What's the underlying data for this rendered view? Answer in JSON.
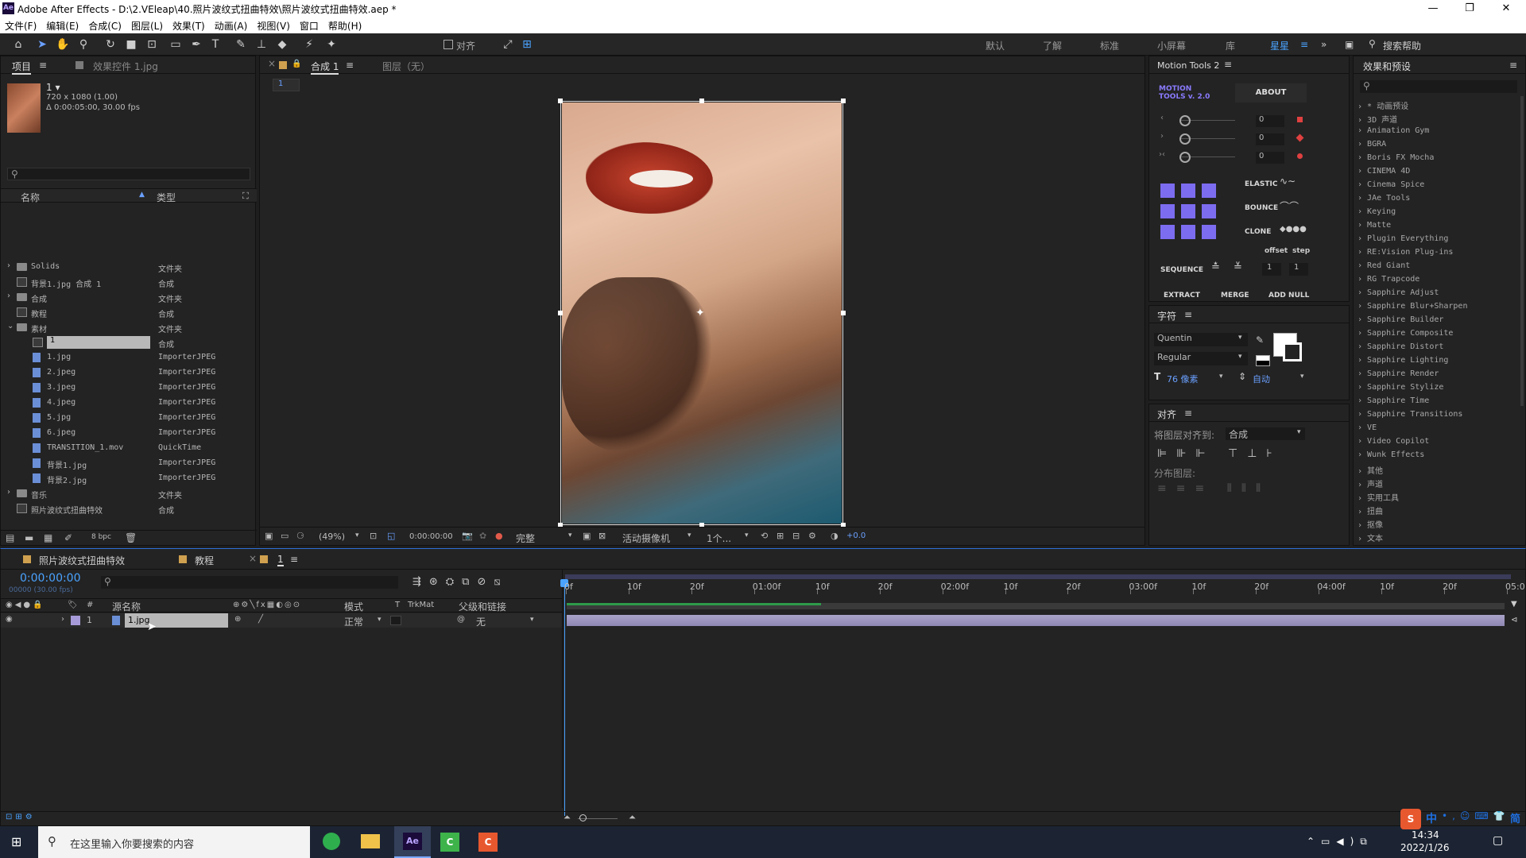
{
  "titlebar": {
    "app_icon": "Ae",
    "title": "Adobe After Effects - D:\\2.VEleap\\40.照片波纹式扭曲特效\\照片波纹式扭曲特效.aep *",
    "minimize": "—",
    "maximize": "❐",
    "close": "✕"
  },
  "menu": [
    "文件(F)",
    "编辑(E)",
    "合成(C)",
    "图层(L)",
    "效果(T)",
    "动画(A)",
    "视图(V)",
    "窗口",
    "帮助(H)"
  ],
  "toolbar": {
    "align_label": "对齐",
    "workspaces": [
      "默认",
      "了解",
      "标准",
      "小屏幕",
      "库",
      "星星"
    ],
    "search_placeholder": "搜索帮助"
  },
  "project": {
    "tab_project": "项目",
    "tab_effects": "效果控件 1.jpg",
    "preview": {
      "name": "1 ▾",
      "size": "720 x 1080 (1.00)",
      "duration": "Δ 0:00:05:00, 30.00 fps"
    },
    "search_placeholder": "",
    "col_name": "名称",
    "col_type": "类型",
    "rows": [
      {
        "name": "Solids",
        "type": "文件夹",
        "icon": "folder"
      },
      {
        "name": "背景1.jpg 合成 1",
        "type": "合成",
        "icon": "comp"
      },
      {
        "name": "合成",
        "type": "文件夹",
        "icon": "folder"
      },
      {
        "name": "教程",
        "type": "合成",
        "icon": "comp"
      },
      {
        "name": "素材",
        "type": "文件夹",
        "icon": "folder"
      },
      {
        "name": "1",
        "type": "合成",
        "icon": "comp"
      },
      {
        "name": "1.jpg",
        "type": "ImporterJPEG",
        "icon": "file"
      },
      {
        "name": "2.jpeg",
        "type": "ImporterJPEG",
        "icon": "file"
      },
      {
        "name": "3.jpeg",
        "type": "ImporterJPEG",
        "icon": "file"
      },
      {
        "name": "4.jpeg",
        "type": "ImporterJPEG",
        "icon": "file"
      },
      {
        "name": "5.jpg",
        "type": "ImporterJPEG",
        "icon": "file"
      },
      {
        "name": "6.jpeg",
        "type": "ImporterJPEG",
        "icon": "file"
      },
      {
        "name": "TRANSITION_1.mov",
        "type": "QuickTime",
        "icon": "file"
      },
      {
        "name": "背景1.jpg",
        "type": "ImporterJPEG",
        "icon": "file"
      },
      {
        "name": "背景2.jpg",
        "type": "ImporterJPEG",
        "icon": "file"
      },
      {
        "name": "音乐",
        "type": "文件夹",
        "icon": "folder"
      },
      {
        "name": "照片波纹式扭曲特效",
        "type": "合成",
        "icon": "comp"
      }
    ],
    "bpc": "8 bpc"
  },
  "comp": {
    "tab": "合成 1",
    "layer_tab": "图层（无）",
    "breadcrumb": "1",
    "zoom": "(49%)",
    "time": "0:00:00:00",
    "quality": "完整",
    "camera": "活动摄像机",
    "views": "1个...",
    "exposure": "+0.0"
  },
  "motion_tools": {
    "title": "Motion Tools 2",
    "logo": "MOTION\nTOOLS v. 2.0",
    "about": "ABOUT",
    "values": [
      "0",
      "0",
      "0"
    ],
    "elastic": "ELASTIC",
    "bounce": "BOUNCE",
    "clone": "CLONE",
    "offset": "offset",
    "step": "step",
    "sequence": "SEQUENCE",
    "seq_values": [
      "1",
      "1"
    ],
    "extract": "EXTRACT",
    "merge": "MERGE",
    "add_null": "ADD NULL"
  },
  "character": {
    "title": "字符",
    "font": "Quentin",
    "style": "Regular",
    "size": "76 像素",
    "leading": "自动"
  },
  "align": {
    "title": "对齐",
    "align_to_label": "将图层对齐到:",
    "align_to_value": "合成",
    "distribute_label": "分布图层:"
  },
  "effects": {
    "title": "效果和预设",
    "items": [
      "* 动画预设",
      "3D 声道",
      "Animation Gym",
      "BGRA",
      "Boris FX Mocha",
      "CINEMA 4D",
      "Cinema Spice",
      "JAe Tools",
      "Keying",
      "Matte",
      "Plugin Everything",
      "RE:Vision Plug-ins",
      "Red Giant",
      "RG Trapcode",
      "Sapphire Adjust",
      "Sapphire Blur+Sharpen",
      "Sapphire Builder",
      "Sapphire Composite",
      "Sapphire Distort",
      "Sapphire Lighting",
      "Sapphire Render",
      "Sapphire Stylize",
      "Sapphire Time",
      "Sapphire Transitions",
      "VE",
      "Video Copilot",
      "Wunk Effects",
      "其他",
      "声道",
      "实用工具",
      "扭曲",
      "抠像",
      "文本"
    ]
  },
  "timeline": {
    "tabs": [
      "照片波纹式扭曲特效",
      "教程",
      "1"
    ],
    "timecode": "0:00:00:00",
    "timecode_sub": "00000 (30.00 fps)",
    "cols": {
      "source": "源名称",
      "mode": "模式",
      "t": "T",
      "trkmat": "TrkMat",
      "parent": "父级和链接"
    },
    "layer": {
      "num": "1",
      "name": "1.jpg",
      "mode": "正常",
      "parent": "无"
    },
    "ticks": [
      "0f",
      "10f",
      "20f",
      "01:00f",
      "10f",
      "20f",
      "02:00f",
      "10f",
      "20f",
      "03:00f",
      "10f",
      "20f",
      "04:00f",
      "10f",
      "20f",
      "05:0"
    ]
  },
  "taskbar": {
    "search_placeholder": "在这里输入你要搜索的内容",
    "time": "14:34",
    "date": "2022/1/26",
    "ime": "中",
    "ime2": "简"
  }
}
